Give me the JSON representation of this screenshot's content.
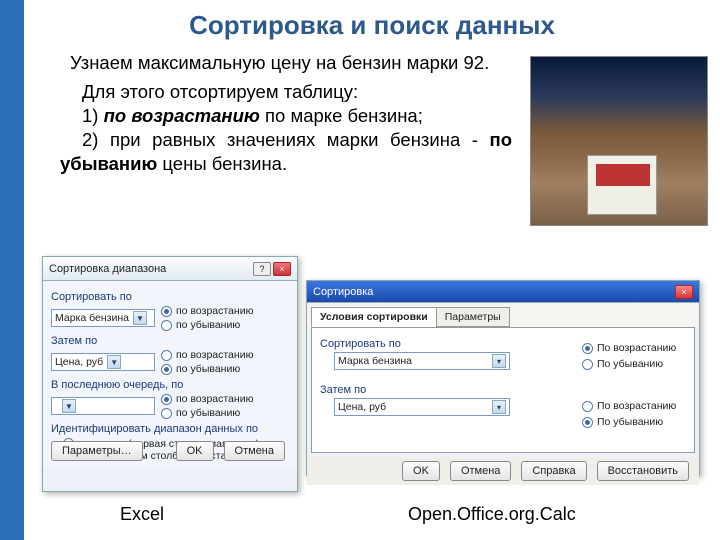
{
  "title": "Сортировка и поиск данных",
  "para1": "Узнаем максимальную цену на бензин марки 92.",
  "para2_1": "Для этого отсортируем таблицу:",
  "para2_2a": "1) ",
  "para2_2b": "по возрастанию",
  "para2_2c": " по марке бензина;",
  "para2_3a": "2) при равных значениях марки бензина - ",
  "para2_3b": "по убыванию",
  "para2_3c": " цены бензина.",
  "captions": {
    "excel": "Excel",
    "calc": "Open.Office.org.Calc"
  },
  "excel": {
    "title": "Сортировка диапазона",
    "help": "?",
    "close": "×",
    "sort_by": "Сортировать по",
    "field1": "Марка бензина",
    "asc": "по возрастанию",
    "desc": "по убыванию",
    "then_by": "Затем по",
    "field2": "Цена, руб",
    "last_by": "В последнюю очередь, по",
    "identify": "Идентифицировать диапазон данных по",
    "opt_labels": "подписям (первая строка диапазона)",
    "opt_cols": "обозначениям столбцов листа",
    "btn_params": "Параметры…",
    "btn_ok": "OK",
    "btn_cancel": "Отмена"
  },
  "calc": {
    "title": "Сортировка",
    "close": "×",
    "tab1": "Условия сортировки",
    "tab2": "Параметры",
    "sort_by": "Сортировать по",
    "field1": "Марка бензина",
    "then_by": "Затем по",
    "field2": "Цена, руб",
    "asc": "По возрастанию",
    "desc": "По убыванию",
    "btn_ok": "OK",
    "btn_cancel": "Отмена",
    "btn_help": "Справка",
    "btn_reset": "Восстановить"
  }
}
